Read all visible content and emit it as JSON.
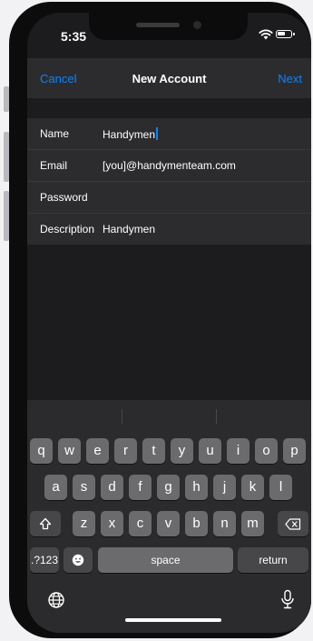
{
  "status_bar": {
    "time": "5:35"
  },
  "nav": {
    "cancel": "Cancel",
    "title": "New Account",
    "next": "Next"
  },
  "form": {
    "rows": [
      {
        "label": "Name",
        "value": "Handymen"
      },
      {
        "label": "Email",
        "value": "[you]@handymenteam.com"
      },
      {
        "label": "Password",
        "value": ""
      },
      {
        "label": "Description",
        "value": "Handymen"
      }
    ]
  },
  "keyboard": {
    "row1": [
      "q",
      "w",
      "e",
      "r",
      "t",
      "y",
      "u",
      "i",
      "o",
      "p"
    ],
    "row2": [
      "a",
      "s",
      "d",
      "f",
      "g",
      "h",
      "j",
      "k",
      "l"
    ],
    "row3": [
      "z",
      "x",
      "c",
      "v",
      "b",
      "n",
      "m"
    ],
    "numbers_key": ".?123",
    "space_key": "space",
    "return_key": "return"
  },
  "colors": {
    "accent": "#0a84ff",
    "background": "#1c1c1e",
    "field_bg": "#2c2c2e",
    "key": "#6b6b6e",
    "key_dark": "#474749"
  }
}
